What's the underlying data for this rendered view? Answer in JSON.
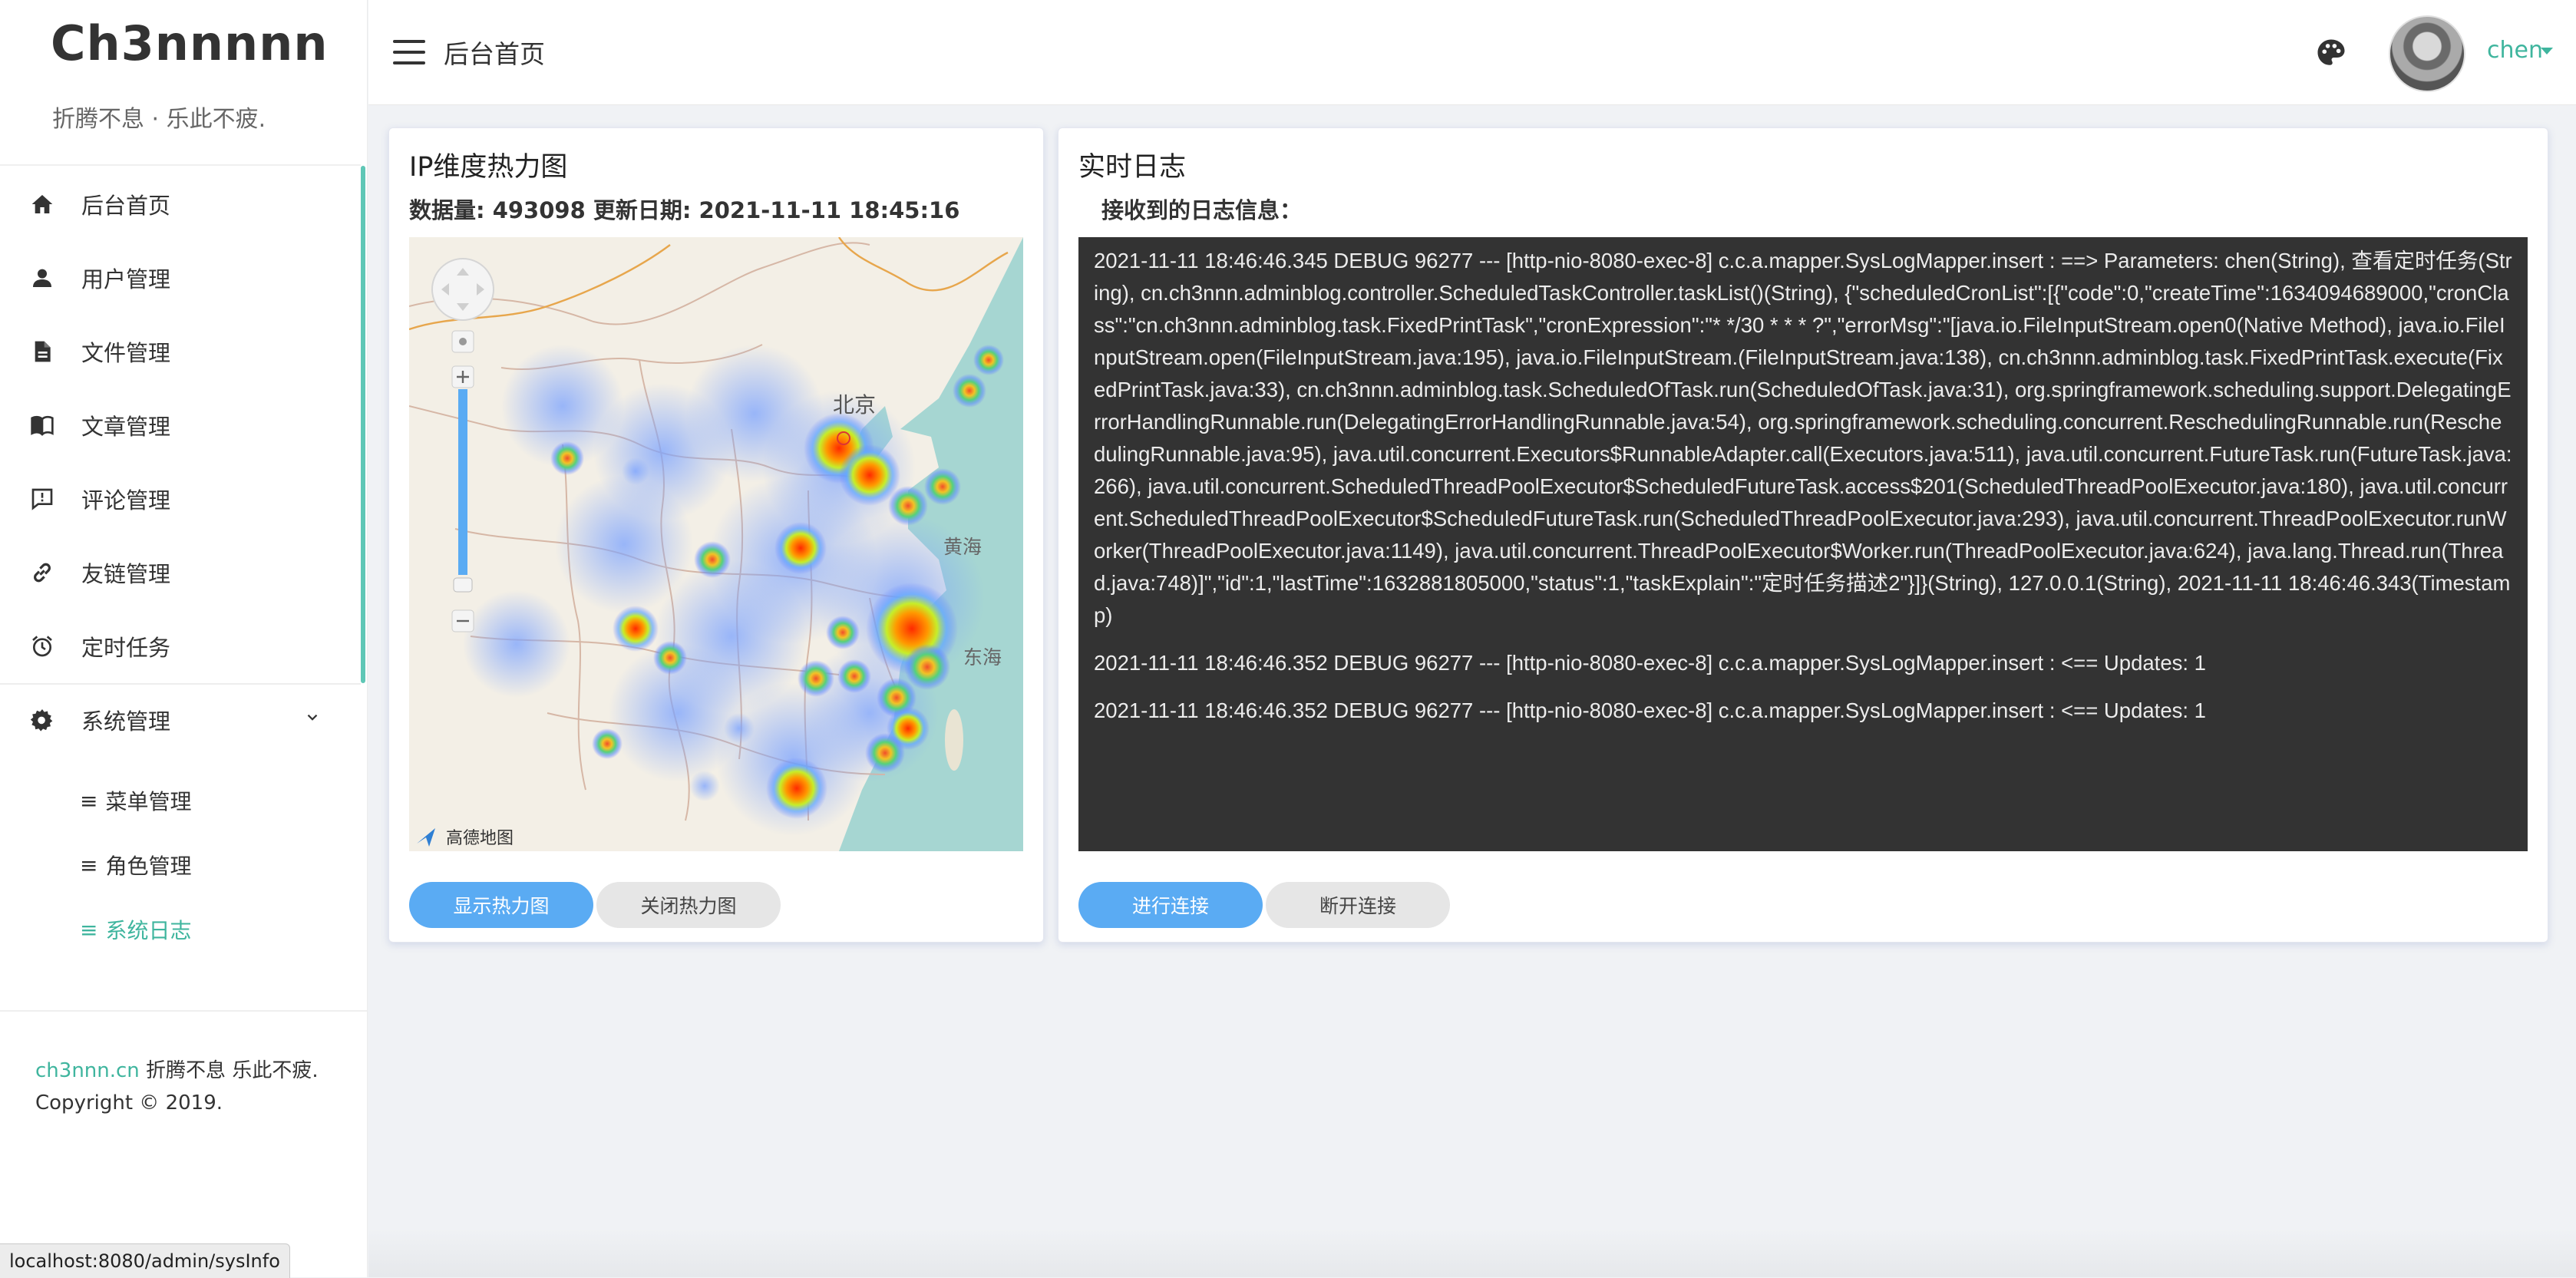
{
  "brand": {
    "title": "Ch3nnnnn",
    "subtitle": "折腾不息 · 乐此不疲."
  },
  "nav": {
    "items": [
      {
        "label": "后台首页",
        "icon": "home-icon"
      },
      {
        "label": "用户管理",
        "icon": "user-icon"
      },
      {
        "label": "文件管理",
        "icon": "file-icon"
      },
      {
        "label": "文章管理",
        "icon": "book-icon"
      },
      {
        "label": "评论管理",
        "icon": "comment-icon"
      },
      {
        "label": "友链管理",
        "icon": "link-icon"
      },
      {
        "label": "定时任务",
        "icon": "alarm-icon"
      },
      {
        "label": "系统管理",
        "icon": "gear-icon"
      }
    ],
    "sub_items": [
      {
        "glyph": "≡",
        "label": "菜单管理"
      },
      {
        "glyph": "≡",
        "label": "角色管理"
      },
      {
        "glyph": "≡",
        "label": "系统日志",
        "active": true
      }
    ]
  },
  "footer": {
    "link": "ch3nnn.cn",
    "slogan": " 折腾不息 乐此不疲.",
    "copyright": "Copyright © 2019."
  },
  "status_bar": {
    "url": "localhost:8080/admin/sysInfo"
  },
  "header": {
    "title": "后台首页",
    "username": "chen"
  },
  "heatmap_card": {
    "title": "IP维度热力图",
    "meta": "数据量: 493098 更新日期: 2021-11-11 18:45:16",
    "map_labels": {
      "beijing": "北京",
      "yellow_sea": "黄海",
      "east_sea": "东海",
      "attribution": "高德地图"
    },
    "buttons": {
      "show": "显示热力图",
      "close": "关闭热力图"
    }
  },
  "log_card": {
    "title": "实时日志",
    "subtitle": "接收到的日志信息：",
    "entries": [
      "2021-11-11 18:46:46.345 DEBUG 96277 --- [http-nio-8080-exec-8] c.c.a.mapper.SysLogMapper.insert : ==> Parameters: chen(String), 查看定时任务(String), cn.ch3nnn.adminblog.controller.ScheduledTaskController.taskList()(String), {\"scheduledCronList\":[{\"code\":0,\"createTime\":1634094689000,\"cronClass\":\"cn.ch3nnn.adminblog.task.FixedPrintTask\",\"cronExpression\":\"* */30 * * * ?\",\"errorMsg\":\"[java.io.FileInputStream.open0(Native Method), java.io.FileInputStream.open(FileInputStream.java:195), java.io.FileInputStream.(FileInputStream.java:138), cn.ch3nnn.adminblog.task.FixedPrintTask.execute(FixedPrintTask.java:33), cn.ch3nnn.adminblog.task.ScheduledOfTask.run(ScheduledOfTask.java:31), org.springframework.scheduling.support.DelegatingErrorHandlingRunnable.run(DelegatingErrorHandlingRunnable.java:54), org.springframework.scheduling.concurrent.ReschedulingRunnable.run(ReschedulingRunnable.java:95), java.util.concurrent.Executors$RunnableAdapter.call(Executors.java:511), java.util.concurrent.FutureTask.run(FutureTask.java:266), java.util.concurrent.ScheduledThreadPoolExecutor$ScheduledFutureTask.access$201(ScheduledThreadPoolExecutor.java:180), java.util.concurrent.ScheduledThreadPoolExecutor$ScheduledFutureTask.run(ScheduledThreadPoolExecutor.java:293), java.util.concurrent.ThreadPoolExecutor.runWorker(ThreadPoolExecutor.java:1149), java.util.concurrent.ThreadPoolExecutor$Worker.run(ThreadPoolExecutor.java:624), java.lang.Thread.run(Thread.java:748)]\",\"id\":1,\"lastTime\":1632881805000,\"status\":1,\"taskExplain\":\"定时任务描述2\"}]}(String), 127.0.0.1(String), 2021-11-11 18:46:46.343(Timestamp)",
      "2021-11-11 18:46:46.352 DEBUG 96277 --- [http-nio-8080-exec-8] c.c.a.mapper.SysLogMapper.insert : <== Updates: 1",
      "2021-11-11 18:46:46.352 DEBUG 96277 --- [http-nio-8080-exec-8] c.c.a.mapper.SysLogMapper.insert : <== Updates: 1"
    ],
    "buttons": {
      "connect": "进行连接",
      "disconnect": "断开连接"
    }
  },
  "colors": {
    "accent": "#3fb59e",
    "primary_button": "#5aabf3",
    "log_background": "#333333"
  }
}
